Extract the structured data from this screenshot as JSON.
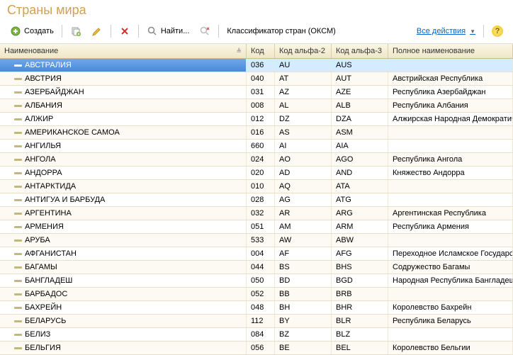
{
  "title": "Страны мира",
  "toolbar": {
    "create": "Создать",
    "find": "Найти...",
    "classifier": "Классификатор стран (ОКСМ)",
    "all_actions": "Все действия"
  },
  "columns": {
    "name": "Наименование",
    "code": "Код",
    "alpha2": "Код альфа-2",
    "alpha3": "Код альфа-3",
    "full": "Полное наименование"
  },
  "rows": [
    {
      "name": "АВСТРАЛИЯ",
      "code": "036",
      "a2": "AU",
      "a3": "AUS",
      "full": "",
      "sel": true
    },
    {
      "name": "АВСТРИЯ",
      "code": "040",
      "a2": "AT",
      "a3": "AUT",
      "full": "Австрийская Республика"
    },
    {
      "name": "АЗЕРБАЙДЖАН",
      "code": "031",
      "a2": "AZ",
      "a3": "AZE",
      "full": "Республика Азербайджан"
    },
    {
      "name": "АЛБАНИЯ",
      "code": "008",
      "a2": "AL",
      "a3": "ALB",
      "full": "Республика Албания"
    },
    {
      "name": "АЛЖИР",
      "code": "012",
      "a2": "DZ",
      "a3": "DZA",
      "full": "Алжирская Народная Демократич"
    },
    {
      "name": "АМЕРИКАНСКОЕ САМОА",
      "code": "016",
      "a2": "AS",
      "a3": "ASM",
      "full": ""
    },
    {
      "name": "АНГИЛЬЯ",
      "code": "660",
      "a2": "AI",
      "a3": "AIA",
      "full": ""
    },
    {
      "name": "АНГОЛА",
      "code": "024",
      "a2": "AO",
      "a3": "AGO",
      "full": "Республика Ангола"
    },
    {
      "name": "АНДОРРА",
      "code": "020",
      "a2": "AD",
      "a3": "AND",
      "full": "Княжество Андорра"
    },
    {
      "name": "АНТАРКТИДА",
      "code": "010",
      "a2": "AQ",
      "a3": "ATA",
      "full": ""
    },
    {
      "name": "АНТИГУА И БАРБУДА",
      "code": "028",
      "a2": "AG",
      "a3": "ATG",
      "full": ""
    },
    {
      "name": "АРГЕНТИНА",
      "code": "032",
      "a2": "AR",
      "a3": "ARG",
      "full": "Аргентинская Республика"
    },
    {
      "name": "АРМЕНИЯ",
      "code": "051",
      "a2": "AM",
      "a3": "ARM",
      "full": "Республика Армения"
    },
    {
      "name": "АРУБА",
      "code": "533",
      "a2": "AW",
      "a3": "ABW",
      "full": ""
    },
    {
      "name": "АФГАНИСТАН",
      "code": "004",
      "a2": "AF",
      "a3": "AFG",
      "full": "Переходное Исламское Государст"
    },
    {
      "name": "БАГАМЫ",
      "code": "044",
      "a2": "BS",
      "a3": "BHS",
      "full": "Содружество Багамы"
    },
    {
      "name": "БАНГЛАДЕШ",
      "code": "050",
      "a2": "BD",
      "a3": "BGD",
      "full": "Народная Республика Бангладеш"
    },
    {
      "name": "БАРБАДОС",
      "code": "052",
      "a2": "BB",
      "a3": "BRB",
      "full": ""
    },
    {
      "name": "БАХРЕЙН",
      "code": "048",
      "a2": "BH",
      "a3": "BHR",
      "full": "Королевство Бахрейн"
    },
    {
      "name": "БЕЛАРУСЬ",
      "code": "112",
      "a2": "BY",
      "a3": "BLR",
      "full": "Республика Беларусь"
    },
    {
      "name": "БЕЛИЗ",
      "code": "084",
      "a2": "BZ",
      "a3": "BLZ",
      "full": ""
    },
    {
      "name": "БЕЛЬГИЯ",
      "code": "056",
      "a2": "BE",
      "a3": "BEL",
      "full": "Королевство Бельгии"
    }
  ]
}
